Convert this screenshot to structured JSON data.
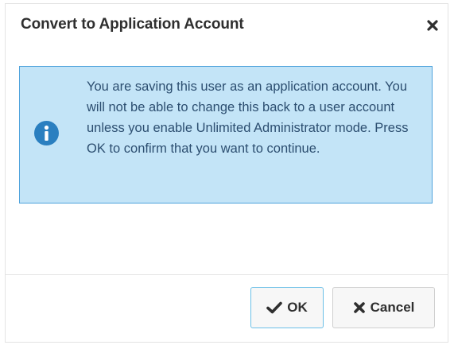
{
  "dialog": {
    "title": "Convert to Application Account",
    "close_icon": "close-icon"
  },
  "alert": {
    "icon": "info-icon",
    "message": "You are saving this user as an application account. You will not be able to change this back to a user account unless you enable Unlimited Administrator mode. Press OK to confirm that you want to continue.",
    "background_color": "#c3e4f7",
    "border_color": "#4fa3dc",
    "icon_color": "#2a7fc0"
  },
  "footer": {
    "ok_label": "OK",
    "ok_icon": "checkmark-icon",
    "cancel_label": "Cancel",
    "cancel_icon": "x-icon"
  }
}
